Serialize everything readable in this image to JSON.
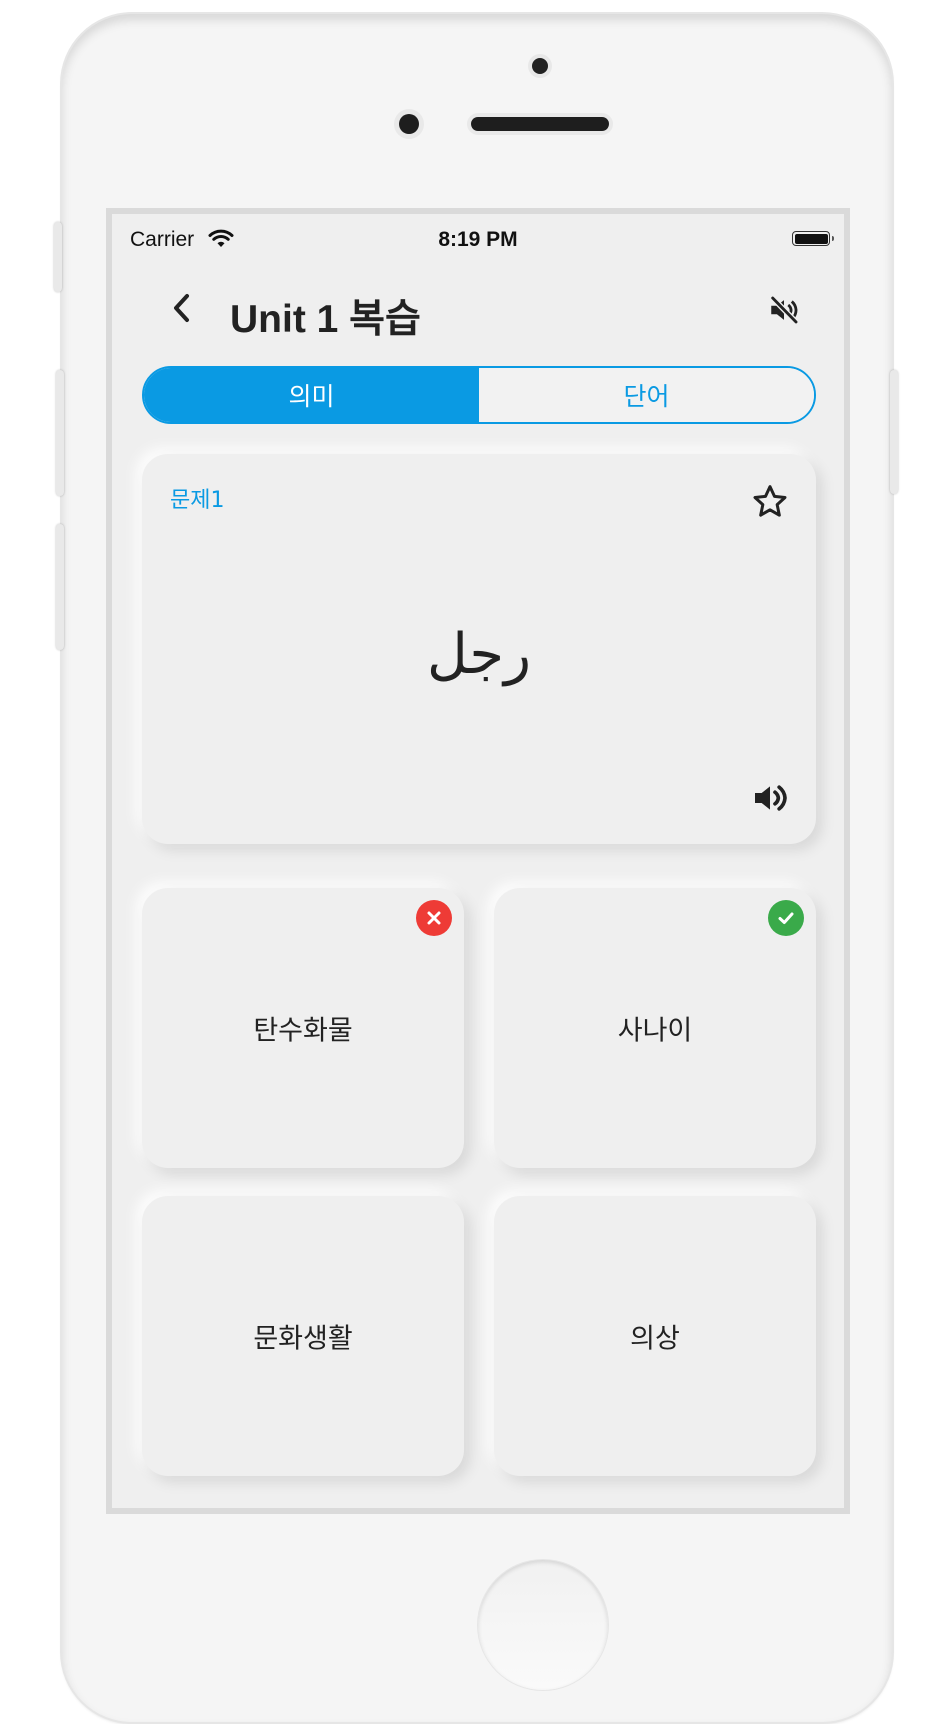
{
  "status_bar": {
    "carrier": "Carrier",
    "time": "8:19 PM"
  },
  "header": {
    "title": "Unit 1 복습"
  },
  "segment": {
    "tabs": [
      {
        "label": "의미",
        "active": true
      },
      {
        "label": "단어",
        "active": false
      }
    ]
  },
  "question": {
    "label": "문제1",
    "word": "رجل"
  },
  "options": [
    {
      "label": "탄수화물",
      "result": "wrong"
    },
    {
      "label": "사나이",
      "result": "correct"
    },
    {
      "label": "문화생활",
      "result": ""
    },
    {
      "label": "의상",
      "result": ""
    }
  ],
  "colors": {
    "accent": "#0a9ae3",
    "wrong": "#ee3b36",
    "correct": "#3aaa4a",
    "background": "#efefef"
  },
  "icons": [
    "wifi-icon",
    "battery-icon",
    "back-chevron-icon",
    "speaker-mute-icon",
    "star-outline-icon",
    "speaker-icon",
    "close-icon",
    "check-icon"
  ]
}
